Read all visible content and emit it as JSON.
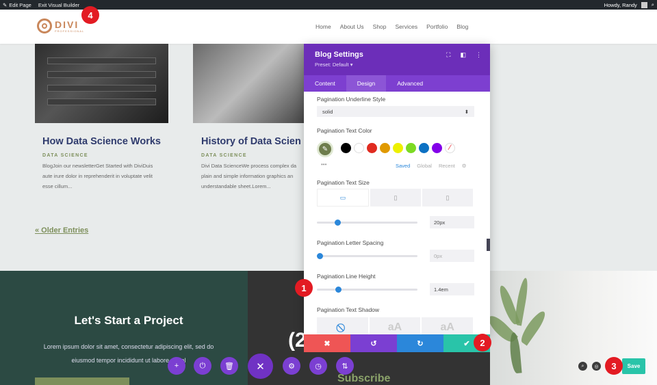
{
  "admin_bar": {
    "edit_page": "Edit Page",
    "exit_builder": "Exit Visual Builder",
    "greeting": "Howdy, Randy"
  },
  "logo": {
    "name": "DIVI",
    "tagline": "PROFESSIONAL"
  },
  "nav": [
    "Home",
    "About Us",
    "Shop",
    "Services",
    "Portfolio",
    "Blog"
  ],
  "posts": [
    {
      "title": "How Data Science Works",
      "category": "DATA SCIENCE",
      "excerpt": "BlogJoin our newsletterGet Started with DiviDuis aute irure dolor in reprehenderit in voluptate velit esse cillum..."
    },
    {
      "title": "History of Data Scien",
      "category": "DATA SCIENCE",
      "excerpt": "Divi Data ScienceWe process complex da plain and simple information graphics an understandable sheet.Lorem..."
    }
  ],
  "older_entries": "« Older Entries",
  "cta": {
    "title": "Let's Start a Project",
    "text": "Lorem ipsum dolor sit amet, consectetur adipiscing elit, sed do eiusmod tempor incididunt ut labore et dol"
  },
  "dark_section": {
    "number": "(2",
    "subscribe": "Subscribe"
  },
  "panel": {
    "title": "Blog Settings",
    "preset": "Preset: Default ▾",
    "tabs": [
      "Content",
      "Design",
      "Advanced"
    ],
    "active_tab": "Design",
    "underline_label": "Pagination Underline Style",
    "underline_value": "solid",
    "text_color_label": "Pagination Text Color",
    "palette_tabs": [
      "Saved",
      "Global",
      "Recent"
    ],
    "swatches": [
      "#000000",
      "#ffffff",
      "#e02b20",
      "#e09900",
      "#edf000",
      "#7cda24",
      "#0c71c3",
      "#8300e9"
    ],
    "selected_color": "#6e7d4c",
    "text_size_label": "Pagination Text Size",
    "text_size_value": "20px",
    "letter_spacing_label": "Pagination Letter Spacing",
    "letter_spacing_value": "0px",
    "line_height_label": "Pagination Line Height",
    "line_height_value": "1.4em",
    "text_shadow_label": "Pagination Text Shadow",
    "shadow_preview": "aA"
  },
  "actions": {
    "cancel_color": "#ef5555",
    "undo_color": "#7b3fd2",
    "redo_color": "#2b87da",
    "save_color": "#29c4a9"
  },
  "save_label": "Save",
  "markers": [
    "1",
    "2",
    "3",
    "4"
  ]
}
